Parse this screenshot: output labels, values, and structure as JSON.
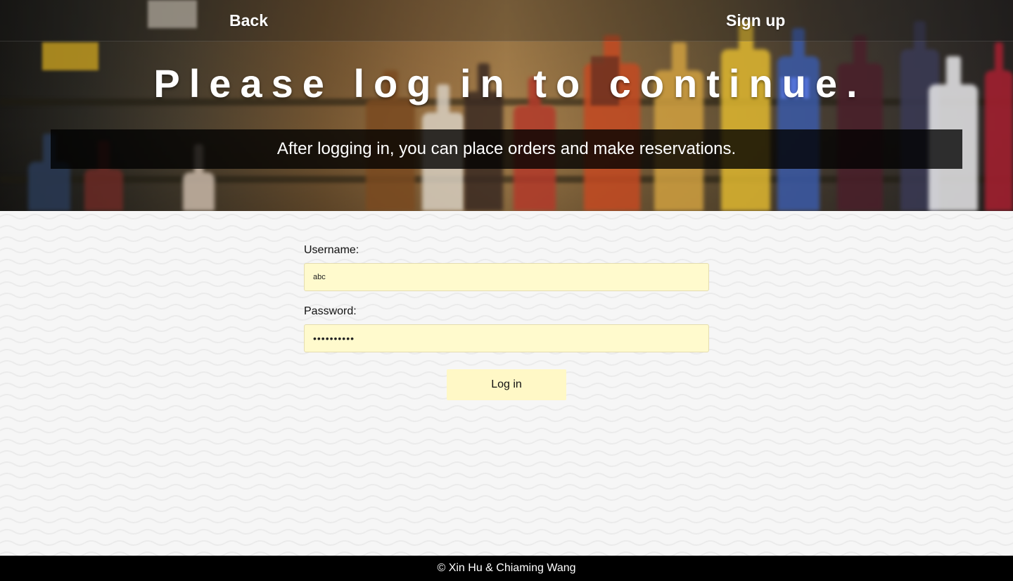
{
  "header": {
    "back_label": "Back",
    "signup_label": "Sign up"
  },
  "hero": {
    "title": "Please log in to continue.",
    "subtitle": "After logging in, you can place orders and make reservations."
  },
  "form": {
    "username_label": "Username:",
    "username_value": "abc",
    "password_label": "Password:",
    "password_value": "abcdefghij",
    "submit_label": "Log in"
  },
  "footer": {
    "text": "© Xin Hu & Chiaming Wang"
  },
  "colors": {
    "input_background": "#fffacd",
    "button_background": "#fff8c6",
    "footer_background": "#000000",
    "subtitle_band": "rgba(0,0,0,0.78)"
  }
}
